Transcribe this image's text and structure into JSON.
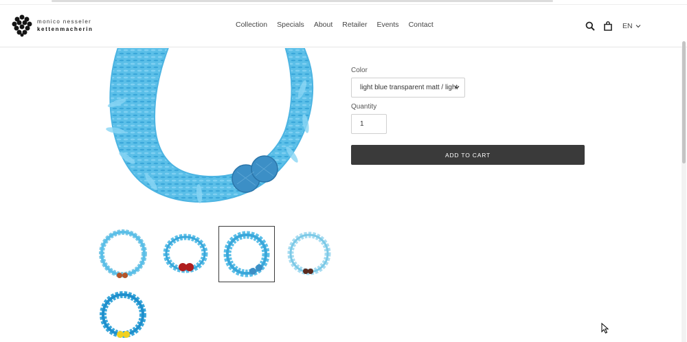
{
  "brand": {
    "line1": "monico nesseler",
    "line2": "kettenmacherin"
  },
  "nav": {
    "items": [
      {
        "label": "Collection"
      },
      {
        "label": "Specials"
      },
      {
        "label": "About"
      },
      {
        "label": "Retailer"
      },
      {
        "label": "Events"
      },
      {
        "label": "Contact"
      }
    ]
  },
  "header_icons": {
    "search": "search-icon",
    "cart": "bag-icon",
    "language": "EN"
  },
  "product": {
    "color_label": "Color",
    "color_value": "light blue transparent matt / light",
    "quantity_label": "Quantity",
    "quantity_value": "1",
    "add_to_cart": "ADD TO CART"
  },
  "gallery": {
    "thumbnails": [
      {
        "name": "thumb-1",
        "bead_color": "#b5552a"
      },
      {
        "name": "thumb-2",
        "bead_color": "#b01e1e"
      },
      {
        "name": "thumb-3",
        "bead_color": "#3c8fc6"
      },
      {
        "name": "thumb-4",
        "bead_color": "#5a2a1e"
      },
      {
        "name": "thumb-5",
        "bead_color": "#f0d020"
      }
    ],
    "active_index": 2
  },
  "colors": {
    "bracelet": "#5bbfe8",
    "bracelet_dark": "#3aa7da",
    "button_bg": "#3a3a3a"
  }
}
